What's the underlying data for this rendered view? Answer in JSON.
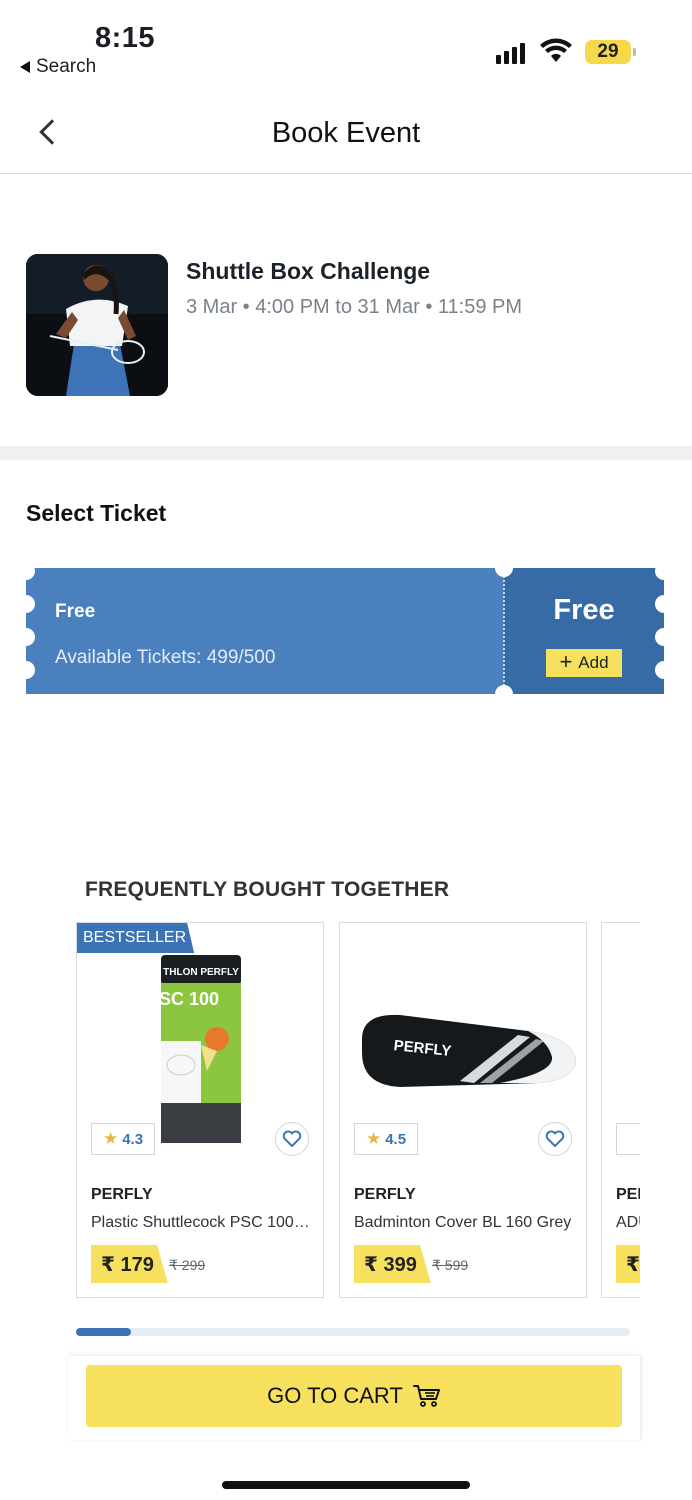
{
  "status_bar": {
    "time": "8:15",
    "back_label": "Search",
    "battery": "29"
  },
  "header": {
    "title": "Book Event",
    "back_icon": "chevron-left-icon"
  },
  "event": {
    "name": "Shuttle Box Challenge",
    "dates": "3 Mar • 4:00 PM to 31 Mar • 11:59 PM"
  },
  "ticket_section": {
    "title": "Select Ticket"
  },
  "ticket": {
    "name": "Free",
    "availability": "Available Tickets:  499/500",
    "price": "Free",
    "add_label": "Add",
    "colors": {
      "left": "#4a80bd",
      "right": "#376ba5",
      "add": "#f6e05e"
    }
  },
  "fbt": {
    "title": "FREQUENTLY BOUGHT TOGETHER",
    "products": [
      {
        "badge": "BESTSELLER",
        "rating": "4.3",
        "brand": "PERFLY",
        "name": "Plastic Shuttlecock PSC 100 M...",
        "price": "₹ 179",
        "mrp": "₹ 299"
      },
      {
        "badge": "",
        "rating": "4.5",
        "brand": "PERFLY",
        "name": "Badminton Cover BL 160 Grey",
        "price": "₹ 399",
        "mrp": "₹ 599"
      },
      {
        "badge": "",
        "rating": "",
        "brand": "PER",
        "name": "ADU",
        "price": "₹",
        "mrp": ""
      }
    ],
    "scroll_progress": 0.1
  },
  "cart": {
    "label": "GO TO CART",
    "icon": "cart-icon"
  },
  "accent_color": "#3c73b4"
}
